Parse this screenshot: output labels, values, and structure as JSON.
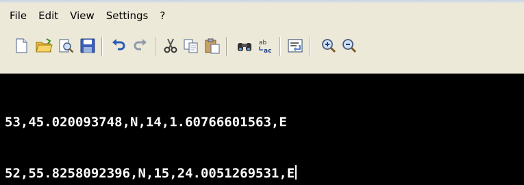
{
  "menu": {
    "items": [
      {
        "label": "File"
      },
      {
        "label": "Edit"
      },
      {
        "label": "View"
      },
      {
        "label": "Settings"
      },
      {
        "label": "?"
      }
    ]
  },
  "toolbar": {
    "buttons": [
      {
        "icon": "new-file-icon"
      },
      {
        "icon": "open-folder-icon"
      },
      {
        "icon": "print-preview-icon"
      },
      {
        "icon": "save-icon"
      },
      {
        "icon": "undo-icon"
      },
      {
        "icon": "redo-icon"
      },
      {
        "icon": "cut-icon"
      },
      {
        "icon": "copy-icon"
      },
      {
        "icon": "paste-icon"
      },
      {
        "icon": "find-icon"
      },
      {
        "icon": "replace-icon"
      },
      {
        "icon": "word-wrap-icon"
      },
      {
        "icon": "zoom-in-icon"
      },
      {
        "icon": "zoom-out-icon"
      }
    ]
  },
  "editor": {
    "lines": [
      "53,45.020093748,N,14,1.60766601563,E",
      "52,55.8258092396,N,15,24.0051269531,E"
    ]
  },
  "colors": {
    "chrome": "#ece9d8",
    "editor_background": "#000000",
    "editor_text": "#ffffff"
  }
}
